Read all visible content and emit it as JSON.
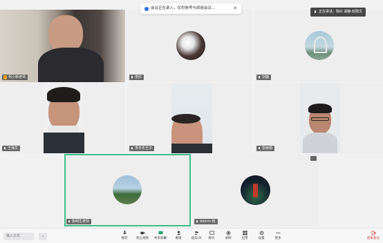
{
  "notification": {
    "text": "会议正在录入，仅供参考与原始会议...",
    "close_glyph": "✕"
  },
  "speaker": {
    "text": "正在讲话：陈红 胡静 赵刚文"
  },
  "participants": [
    {
      "name": "柯小新老师",
      "host": true
    },
    {
      "name": "李红"
    },
    {
      "name": "刘静"
    },
    {
      "name": "王海文"
    },
    {
      "name": "李冬冬王子"
    },
    {
      "name": "张雨桐"
    },
    {
      "name": "陈明生老师"
    },
    {
      "name": "Admin 晓"
    }
  ],
  "toolbar": {
    "input_placeholder": "输入文本",
    "chevron_glyph": "‹",
    "buttons": [
      {
        "label": "静音",
        "icon": "mic-icon"
      },
      {
        "label": "停止视频",
        "icon": "camera-icon"
      },
      {
        "label": "共享屏幕",
        "icon": "share-screen-icon"
      },
      {
        "label": "邀请",
        "icon": "invite-icon"
      },
      {
        "label": "成员(9)",
        "icon": "members-icon"
      },
      {
        "label": "聊天",
        "icon": "chat-icon"
      },
      {
        "label": "录制",
        "icon": "record-icon"
      },
      {
        "label": "应用",
        "icon": "apps-icon"
      },
      {
        "label": "设置",
        "icon": "settings-icon"
      },
      {
        "label": "更多",
        "icon": "more-icon"
      }
    ],
    "leave_label": "结束会议"
  },
  "colors": {
    "active_border": "#3bbf8a",
    "accent": "#2c6fe0",
    "leave": "#d63b3b"
  }
}
